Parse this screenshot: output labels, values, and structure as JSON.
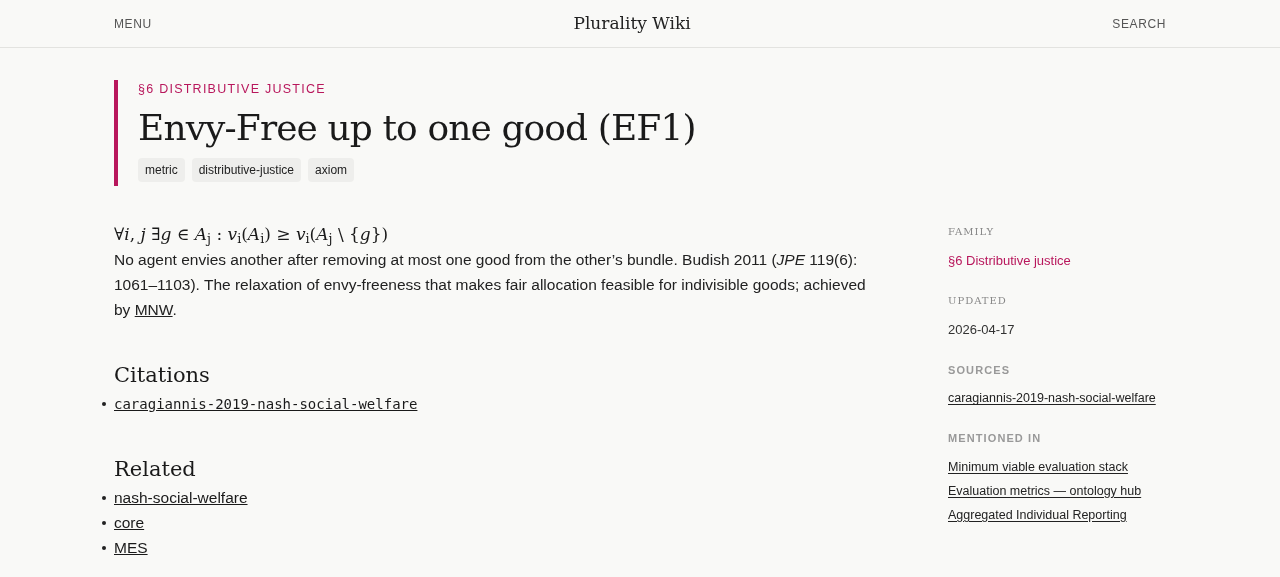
{
  "header": {
    "menu": "MENU",
    "title": "Plurality Wiki",
    "search": "SEARCH"
  },
  "article": {
    "section": "§6 DISTRIBUTIVE JUSTICE",
    "title": "Envy-Free up to one good (EF1)",
    "tags": [
      "metric",
      "distributive-justice",
      "axiom"
    ],
    "formula": "∀*i*, *j* ∃*g* ∈ *A*$_{j}$ : *v*$_{i}$(*A*$_{i}$) ≥ *v*$_{i}$(*A*$_{j}$ \\ {*g*})",
    "description": {
      "text": "No agent envies another after removing at most one good from the other’s bundle. Budish 2011 (*JPE* 119(6): 1061–1103). The relaxation of envy-freeness that makes fair allocation feasible for indivisible goods; achieved by ",
      "link": "MNW",
      "end": "."
    },
    "citations": {
      "heading": "Citations",
      "items": [
        "caragiannis-2019-nash-social-welfare"
      ]
    },
    "related": {
      "heading": "Related",
      "items": [
        "nash-social-welfare",
        "core",
        "MES"
      ]
    }
  },
  "sidebar": [
    {
      "kind": "serif",
      "label": "FAMILY",
      "items": [
        {
          "text": "§6 Distributive justice",
          "kind": "accent"
        }
      ]
    },
    {
      "kind": "serif",
      "label": "UPDATED",
      "items": [
        {
          "text": "2026-04-17",
          "kind": "plain"
        }
      ]
    },
    {
      "kind": "sans",
      "label": "SOURCES",
      "items": [
        {
          "text": "caragiannis-2019-nash-social-welfare",
          "kind": "link"
        }
      ]
    },
    {
      "kind": "sans",
      "label": "MENTIONED IN",
      "items": [
        {
          "text": "Minimum viable evaluation stack",
          "kind": "link"
        },
        {
          "text": "Evaluation metrics — ontology hub",
          "kind": "link"
        },
        {
          "text": "Aggregated Individual Reporting",
          "kind": "link"
        }
      ]
    }
  ]
}
